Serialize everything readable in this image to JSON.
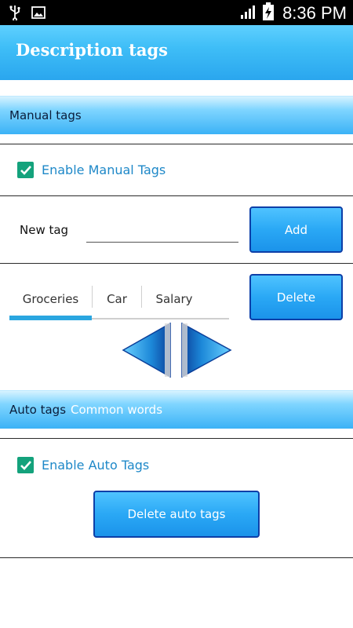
{
  "status_bar": {
    "time": "8:36 PM",
    "icons": [
      "usb-icon",
      "image-icon",
      "signal-icon",
      "battery-charging-icon"
    ]
  },
  "action_bar": {
    "title": "Description tags"
  },
  "manual_section": {
    "header": "Manual tags",
    "enable_label": "Enable Manual Tags",
    "enable_checked": true,
    "new_tag_label": "New tag",
    "new_tag_value": "",
    "add_button": "Add",
    "tabs": [
      {
        "label": "Groceries",
        "selected": true
      },
      {
        "label": "Car",
        "selected": false
      },
      {
        "label": "Salary",
        "selected": false
      }
    ],
    "delete_button": "Delete",
    "nav_icons": [
      "arrow-left-icon",
      "arrow-right-icon"
    ]
  },
  "auto_section": {
    "header": "Auto tags",
    "header_secondary": "Common words",
    "enable_label": "Enable Auto Tags",
    "enable_checked": true,
    "delete_button": "Delete auto tags"
  },
  "colors": {
    "accent": "#2aa6ee",
    "checkbox": "#14a27c",
    "link_text": "#1e88c8",
    "button_border": "#0d3fa8"
  }
}
